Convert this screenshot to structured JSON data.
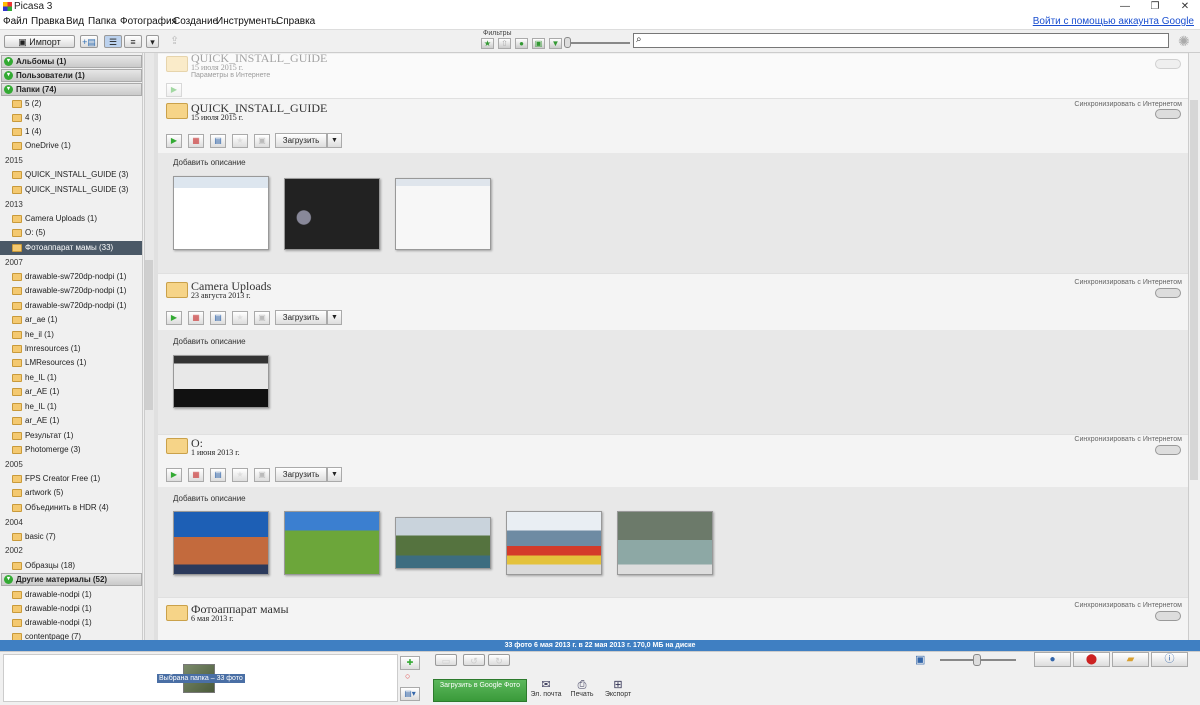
{
  "window": {
    "title": "Picasa 3",
    "controls": [
      "—",
      "❐",
      "✕"
    ]
  },
  "menu": {
    "items": [
      "Файл",
      "Правка",
      "Вид",
      "Папка",
      "Фотография",
      "Создание",
      "Инструменты",
      "Справка"
    ],
    "login": "Войти с помощью аккаунта Google"
  },
  "toolbar": {
    "import_label": "Импорт",
    "filters_label": "Фильтры"
  },
  "sidebar": {
    "sections": {
      "albums": "Альбомы (1)",
      "users": "Пользователи (1)",
      "folders": "Папки (74)",
      "other": "Другие материалы (52)"
    },
    "items": [
      {
        "label": "5 (2)"
      },
      {
        "label": "4 (3)"
      },
      {
        "label": "1 (4)"
      },
      {
        "label": "OneDrive (1)"
      },
      {
        "label": "QUICK_INSTALL_GUIDE (3)"
      },
      {
        "label": "QUICK_INSTALL_GUIDE (3)"
      },
      {
        "label": "Camera Uploads (1)"
      },
      {
        "label": "O: (5)"
      },
      {
        "label": "Фотоаппарат мамы (33)"
      },
      {
        "label": "drawable-sw720dp-nodpi (1)"
      },
      {
        "label": "drawable-sw720dp-nodpi (1)"
      },
      {
        "label": "drawable-sw720dp-nodpi (1)"
      },
      {
        "label": "ar_ae (1)"
      },
      {
        "label": "he_il (1)"
      },
      {
        "label": "lmresources (1)"
      },
      {
        "label": "LMResources (1)"
      },
      {
        "label": "he_IL (1)"
      },
      {
        "label": "ar_AE (1)"
      },
      {
        "label": "he_IL (1)"
      },
      {
        "label": "ar_AE (1)"
      },
      {
        "label": "Результат (1)"
      },
      {
        "label": "Photomerge (3)"
      },
      {
        "label": "FPS Creator Free (1)"
      },
      {
        "label": "artwork (5)"
      },
      {
        "label": "Объединить в HDR (4)"
      },
      {
        "label": "basic (7)"
      },
      {
        "label": "Образцы (18)"
      },
      {
        "label": "drawable-nodpi (1)"
      },
      {
        "label": "drawable-nodpi (1)"
      },
      {
        "label": "drawable-nodpi (1)"
      },
      {
        "label": "contentpage (7)"
      }
    ],
    "years": [
      "2015",
      "2013",
      "2007",
      "2005",
      "2004",
      "2002"
    ]
  },
  "albums": [
    {
      "title": "QUICK_INSTALL_GUIDE",
      "date": "15 июля 2015 г.",
      "sub": "Параметры в Интернете"
    },
    {
      "title": "QUICK_INSTALL_GUIDE",
      "date": "15 июля 2015 г.",
      "sync": "Синхронизировать с Интернетом",
      "upload": "Загрузить",
      "desc": "Добавить описание"
    },
    {
      "title": "Camera Uploads",
      "date": "23 августа 2013 г.",
      "sync": "Синхронизировать с Интернетом",
      "upload": "Загрузить",
      "desc": "Добавить описание"
    },
    {
      "title": "O:",
      "date": "1 июня 2013 г.",
      "sync": "Синхронизировать с Интернетом",
      "upload": "Загрузить",
      "desc": "Добавить описание"
    },
    {
      "title": "Фотоаппарат мамы",
      "date": "6 мая 2013 г.",
      "sync": "Синхронизировать с Интернетом",
      "upload": "Загрузить"
    }
  ],
  "status": {
    "text": "33 фото      6 мая 2013 г. в 22 мая 2013 г.      170,0 МБ на диске"
  },
  "bottom": {
    "tray_label": "Выбрана папка – 33 фото",
    "google_upload": "Загрузить в Google Фото",
    "email": "Эл. почта",
    "print": "Печать",
    "export": "Экспорт"
  }
}
